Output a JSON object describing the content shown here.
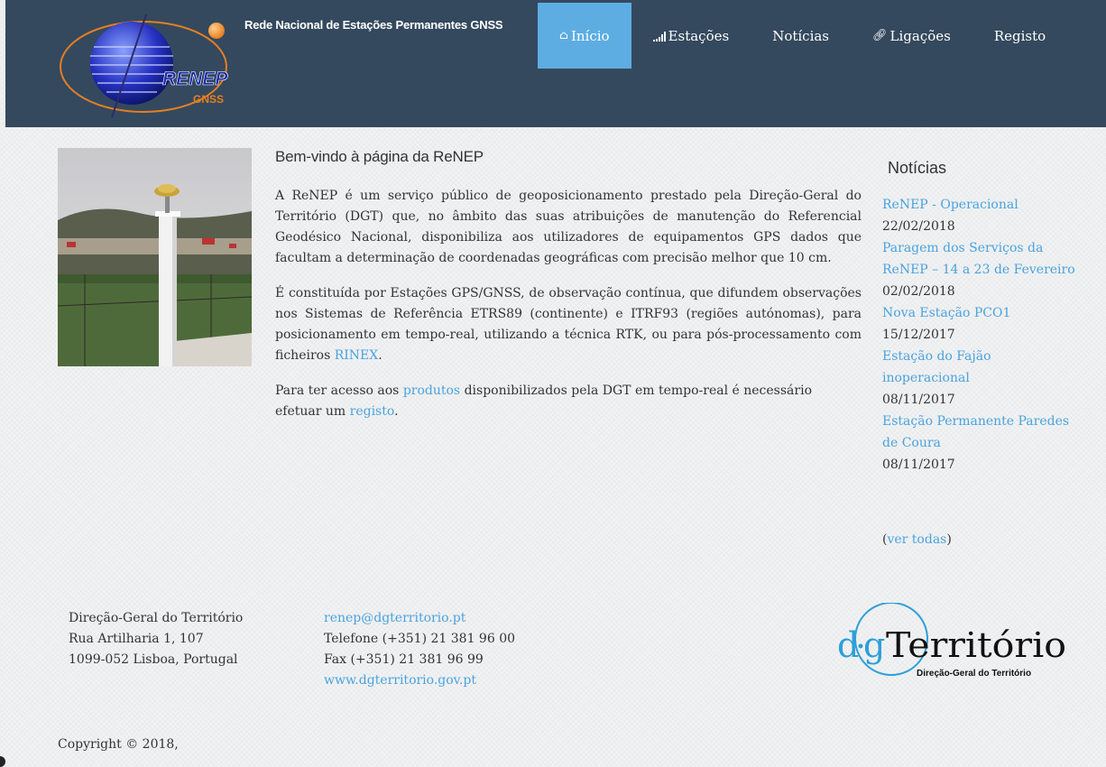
{
  "header": {
    "site_title": "Rede Nacional de Estações Permanentes GNSS",
    "logo_text": "RENEP",
    "logo_subtext": "GNSS",
    "nav": [
      {
        "label": "Início",
        "icon": "home-icon",
        "active": true
      },
      {
        "label": "Estações",
        "icon": "signal-icon",
        "active": false
      },
      {
        "label": "Notícias",
        "icon": "",
        "active": false
      },
      {
        "label": "Ligações",
        "icon": "link-icon",
        "active": false
      },
      {
        "label": "Registo",
        "icon": "",
        "active": false
      }
    ]
  },
  "intro": {
    "heading": "Bem-vindo à página da ReNEP",
    "p1": "A ReNEP é um serviço público de geoposicionamento prestado pela Direção-Geral do Território (DGT) que, no âmbito das suas atribuições de manutenção do Referencial Geodésico Nacional, disponibiliza aos utilizadores de equipamentos GPS dados que facultam a determinação de coordenadas geográficas com precisão melhor que 10 cm.",
    "p2_before": "É constituída por Estações GPS/GNSS, de observação contínua, que difundem observações nos Sistemas de Referência ETRS89 (continente) e ITRF93 (regiões autónomas), para posicionamento em tempo-real, utilizando a técnica RTK, ou para pós-processamento com ficheiros ",
    "p2_link": "RINEX",
    "p2_after": ".",
    "p3_before": "Para ter acesso aos ",
    "p3_link1": "produtos",
    "p3_middle": " disponibilizados pela DGT em tempo-real é necessário efetuar um ",
    "p3_link2": "registo",
    "p3_after": "."
  },
  "news": {
    "heading": "Notícias",
    "items": [
      {
        "title": "ReNEP - Operacional",
        "date": "22/02/2018"
      },
      {
        "title": "Paragem dos Serviços da ReNEP – 14 a 23 de Fevereiro",
        "date": "02/02/2018"
      },
      {
        "title": "Nova Estação PCO1",
        "date": "15/12/2017"
      },
      {
        "title": "Estação do Fajão inoperacional",
        "date": "08/11/2017"
      },
      {
        "title": "Estação Permanente Paredes de Coura",
        "date": "08/11/2017"
      }
    ],
    "see_all_open": "(",
    "see_all": "ver todas",
    "see_all_close": ")"
  },
  "footer": {
    "address": [
      "Direção-Geral do Território",
      "Rua Artilharia 1, 107",
      "1099-052 Lisboa, Portugal"
    ],
    "email": "renep@dgterritorio.pt",
    "phone": "Telefone (+351) 21 381 96 00",
    "fax": "Fax (+351) 21 381 96 99",
    "website": "www.dgterritorio.gov.pt",
    "dgt_logo_main": "Território",
    "dgt_logo_sub": "Direção-Geral do Território",
    "copyright": "Copyright © 2018,"
  },
  "colors": {
    "header_bg": "#34495e",
    "nav_active": "#5dade2",
    "link": "#4aa3df"
  }
}
